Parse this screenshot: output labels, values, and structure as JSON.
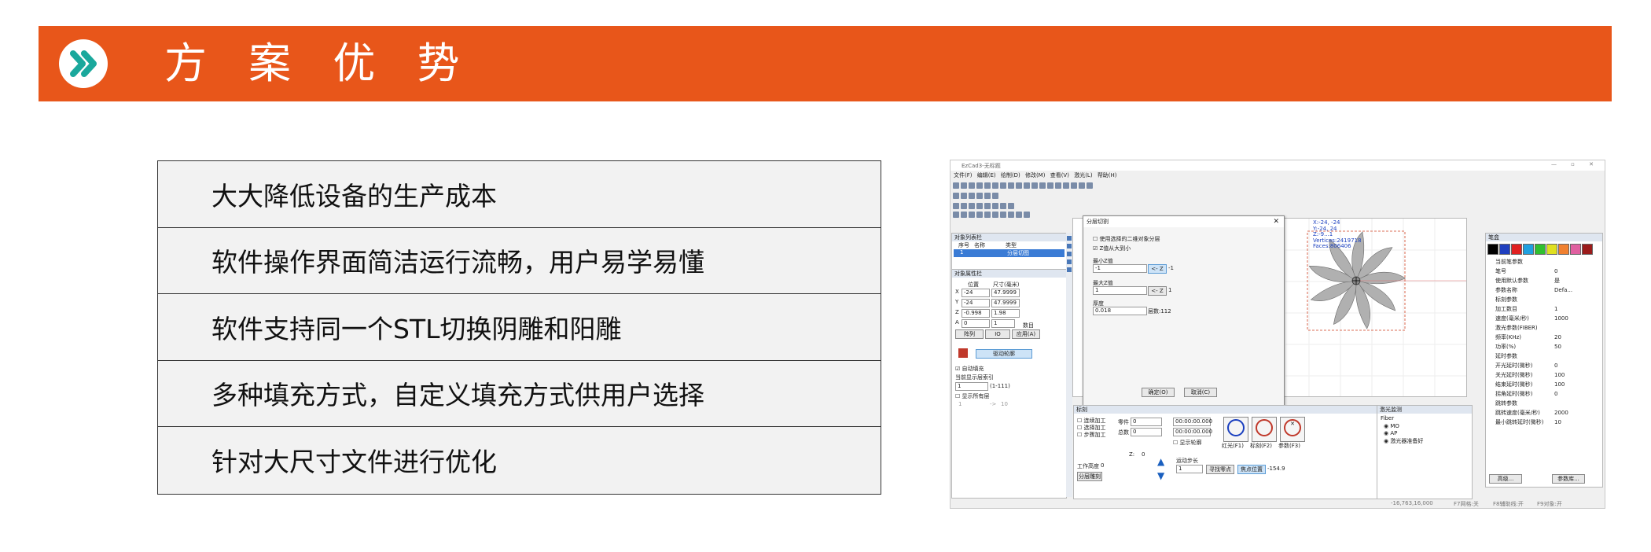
{
  "banner": {
    "title": "方 案 优 势",
    "icon": "double-chevron-right-icon",
    "color": "#e8561a"
  },
  "features": [
    "大大降低设备的生产成本",
    "软件操作界面简洁运行流畅，用户易学易懂",
    "软件支持同一个STL切换阴雕和阳雕",
    "多种填充方式，自定义填充方式供用户选择",
    "针对大尺寸文件进行优化"
  ],
  "app": {
    "title": "EzCad3-无标题",
    "menu": [
      "文件(F)",
      "编辑(E)",
      "绘制(D)",
      "修改(M)",
      "查看(V)",
      "激光(L)",
      "帮助(H)"
    ],
    "object_list": {
      "title": "对象列表栏",
      "headers": [
        "序号",
        "名称",
        "类型"
      ],
      "rows": [
        [
          "1",
          "",
          "分层切图"
        ]
      ]
    },
    "props": {
      "title": "对象属性栏",
      "pos_label": "位置",
      "size_label": "尺寸(毫米)",
      "x_label": "X",
      "x_pos": "-24",
      "x_size": "47.9999",
      "y_label": "Y",
      "y_pos": "-24",
      "y_size": "47.9999",
      "z_label": "Z",
      "z_pos": "-0.998",
      "z_size": "1.98",
      "a_label": "A",
      "a_pos": "0",
      "a_size": "1",
      "count_label": "数目",
      "buttons": [
        "阵列",
        "IO",
        "应用(A)"
      ],
      "drive_btn": "驱动轮廓",
      "auto_fill": "自动填充",
      "layer_label": "当前显示层索引",
      "layer_value": "1",
      "layer_range": "(1-111)",
      "show_all": "显示所有层",
      "range_from": "1",
      "range_arrow": "->",
      "range_to": "10"
    },
    "dialog": {
      "title": "分层切割",
      "opt1": "使用选择的二维对象分层",
      "opt2": "Z值从大到小",
      "min_label": "最小Z值",
      "min_value": "-1",
      "min_btn": "<- Z",
      "min_suffix": "-1",
      "max_label": "最大Z值",
      "max_value": "1",
      "max_btn": "<- Z",
      "max_suffix": "1",
      "thick_label": "厚度",
      "thick_value": "0.018",
      "layers_text": "层数:112",
      "ok": "确定(O)",
      "cancel": "取消(C)"
    },
    "viewport": {
      "coords": "X:-24, -24\nY:-24, 24\nZ:-9...1\nVertices:2419718\nFaces:806406"
    },
    "pen": {
      "title": "笔盒",
      "colors": [
        "#000000",
        "#1f3fbf",
        "#e02020",
        "#20a0e0",
        "#30c030",
        "#e0e020",
        "#f08030",
        "#e060a0",
        "#9b1b1b"
      ],
      "rows": [
        {
          "k": "当前笔参数",
          "v": ""
        },
        {
          "k": "笔号",
          "v": "0"
        },
        {
          "k": "使用默认参数",
          "v": "是"
        },
        {
          "k": "参数名称",
          "v": "Defa..."
        },
        {
          "k": "标刻参数",
          "v": ""
        },
        {
          "k": "加工数目",
          "v": "1"
        },
        {
          "k": "速度(毫米/秒)",
          "v": "1000"
        },
        {
          "k": "激光参数(FIBER)",
          "v": ""
        },
        {
          "k": "频率(KHz)",
          "v": "20"
        },
        {
          "k": "功率(%)",
          "v": "50"
        },
        {
          "k": "延时参数",
          "v": ""
        },
        {
          "k": "开光延时(微秒)",
          "v": "0"
        },
        {
          "k": "关光延时(微秒)",
          "v": "100"
        },
        {
          "k": "结束延时(微秒)",
          "v": "100"
        },
        {
          "k": "拐角延时(微秒)",
          "v": "0"
        },
        {
          "k": "跳转参数",
          "v": ""
        },
        {
          "k": "跳转速度(毫米/秒)",
          "v": "2000"
        },
        {
          "k": "最小跳转延时(微秒)",
          "v": "10"
        }
      ],
      "advanced": "高级...",
      "params": "参数库..."
    },
    "mark": {
      "title": "标刻",
      "chk1": "连续加工",
      "chk2": "选择加工",
      "chk3": "步骤加工",
      "parts_label": "零件",
      "parts_value": "0",
      "total_label": "总数",
      "total_value": "0",
      "time1": "00:00:00.000",
      "time2": "00:00:00.000",
      "show_contour": "显示轮廓",
      "red": "红光(F1)",
      "mark_btn": "标刻(F2)",
      "param_btn": "参数(F3)",
      "z_label": "Z:",
      "z_value": "0",
      "work_height": "工作高度",
      "work_value": "0",
      "layered": "分层雕刻",
      "move_label": "运动步长",
      "move_value": "1",
      "find_zero": "寻找零点",
      "focus": "焦点位置",
      "focus_value": "-154.9"
    },
    "laser": {
      "title": "激光监测",
      "type": "Fiber",
      "mo": "MO",
      "ap": "AP",
      "ready": "激光器准备好"
    },
    "status": {
      "coord": "-16,763,16,000",
      "f7": "F7网格:关",
      "f8": "F8辅助线:开",
      "f9": "F9对象:开"
    }
  }
}
